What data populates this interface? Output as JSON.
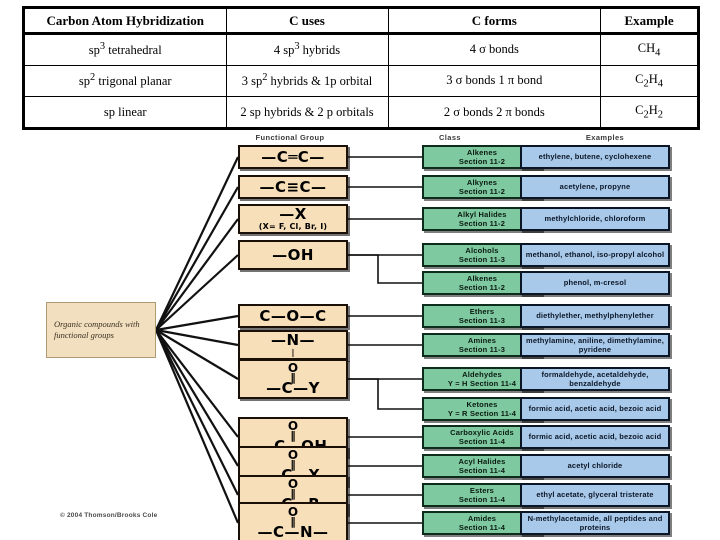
{
  "hybridization_table": {
    "name": "Carbon Atom Hybridization Table",
    "headers": [
      "Carbon Atom Hybridization",
      "C uses",
      "C forms",
      "Example"
    ],
    "rows": [
      {
        "hybridization": "sp3 tetrahedral",
        "hybridization_html": "sp<sup>3</sup> tetrahedral",
        "c_uses": "4 sp3 hybrids",
        "c_uses_html": "4 sp<sup>3</sup> hybrids",
        "c_forms": "4 σ bonds",
        "example": "CH4",
        "example_html": "CH<sub>4</sub>"
      },
      {
        "hybridization": "sp2 trigonal planar",
        "hybridization_html": "sp<sup>2</sup> trigonal planar",
        "c_uses": "3 sp2 hybrids & 1p orbital",
        "c_uses_html": "3 sp<sup>2</sup> hybrids & 1p orbital",
        "c_forms": "3 σ bonds 1 π bond",
        "example": "C2H4",
        "example_html": "C<sub>2</sub>H<sub>4</sub>"
      },
      {
        "hybridization": "sp linear",
        "hybridization_html": "sp linear",
        "c_uses": "2 sp hybrids & 2 p orbitals",
        "c_uses_html": "2 sp hybrids &amp; 2 p orbitals",
        "c_forms": "2 σ bonds 2 π bonds",
        "example": "C2H2",
        "example_html": "C<sub>2</sub>H<sub>2</sub>"
      }
    ]
  },
  "diagram": {
    "column_headers": {
      "functional_group": "Functional Group",
      "class": "Class",
      "examples": "Examples"
    },
    "origin_label": "Organic compounds with functional groups",
    "copyright": "© 2004 Thomson/Brooks Cole",
    "colors": {
      "functional_group_fill": "#f7dfba",
      "class_fill": "#7ec9a0",
      "examples_fill": "#a9c9ea",
      "origin_fill": "#f2dfc0",
      "connector": "#111111"
    },
    "rows": [
      {
        "group_formula": "—C═C—",
        "group_top": "",
        "group_sub": "",
        "class": "Alkenes",
        "class_section": "Section 11-2",
        "examples": "ethylene, butene, cyclohexene"
      },
      {
        "group_formula": "—C≡C—",
        "group_top": "",
        "group_sub": "",
        "class": "Alkynes",
        "class_section": "Section 11-2",
        "examples": "acetylene, propyne"
      },
      {
        "group_formula": "—X",
        "group_top": "",
        "group_sub": "(X= F, Cl, Br, I)",
        "class": "Alkyl Halides",
        "class_section": "Section 11-2",
        "examples": "methylchloride, chloroform"
      },
      {
        "group_formula": "—OH",
        "group_top": "",
        "group_sub": "",
        "class": "Alcohols",
        "class_section": "Section 11-3",
        "examples": "methanol, ethanol, iso-propyl alcohol"
      },
      {
        "group_formula": "—OH",
        "group_top": "",
        "group_sub": "",
        "class": "Alkenes",
        "class_section": "Section 11-2",
        "examples": "phenol, m-cresol",
        "shared_group_with_previous": true
      },
      {
        "group_formula": "C—O—C",
        "group_top": "",
        "group_sub": "",
        "class": "Ethers",
        "class_section": "Section 11-3",
        "examples": "diethylether, methylphenylether"
      },
      {
        "group_formula": "—N—",
        "group_top": "",
        "group_sub": "|",
        "class": "Amines",
        "class_section": "Section 11-3",
        "examples": "methylamine, aniline, dimethylamine, pyridene"
      },
      {
        "group_formula": "—C—Y",
        "group_top": "O",
        "group_sub": "",
        "class": "Aldehydes",
        "class_section": "Y = H Section 11-4",
        "examples": "formaldehyde, acetaldehyde, benzaldehyde"
      },
      {
        "group_formula": "—C—Y",
        "group_top": "O",
        "group_sub": "",
        "class": "Ketones",
        "class_section": "Y = R Section 11-4",
        "examples": "formic acid, acetic acid, bezoic acid",
        "shared_group_with_previous": true
      },
      {
        "group_formula": "—C—OH",
        "group_top": "O",
        "group_sub": "",
        "class": "Carboxylic Acids",
        "class_section": "Section 11-4",
        "examples": "formic acid, acetic acid, bezoic acid"
      },
      {
        "group_formula": "—C—X",
        "group_top": "O",
        "group_sub": "",
        "class": "Acyl Halides",
        "class_section": "Section 11-4",
        "examples": "acetyl chloride"
      },
      {
        "group_formula": "—C—R",
        "group_top": "O",
        "group_sub": "",
        "class": "Esters",
        "class_section": "Section 11-4",
        "examples": "ethyl acetate, glyceral tristerate"
      },
      {
        "group_formula": "—C—N—",
        "group_top": "O",
        "group_sub": "",
        "class": "Amides",
        "class_section": "Section 11-4",
        "examples": "N-methylacetamide, all peptides and proteins"
      }
    ]
  }
}
